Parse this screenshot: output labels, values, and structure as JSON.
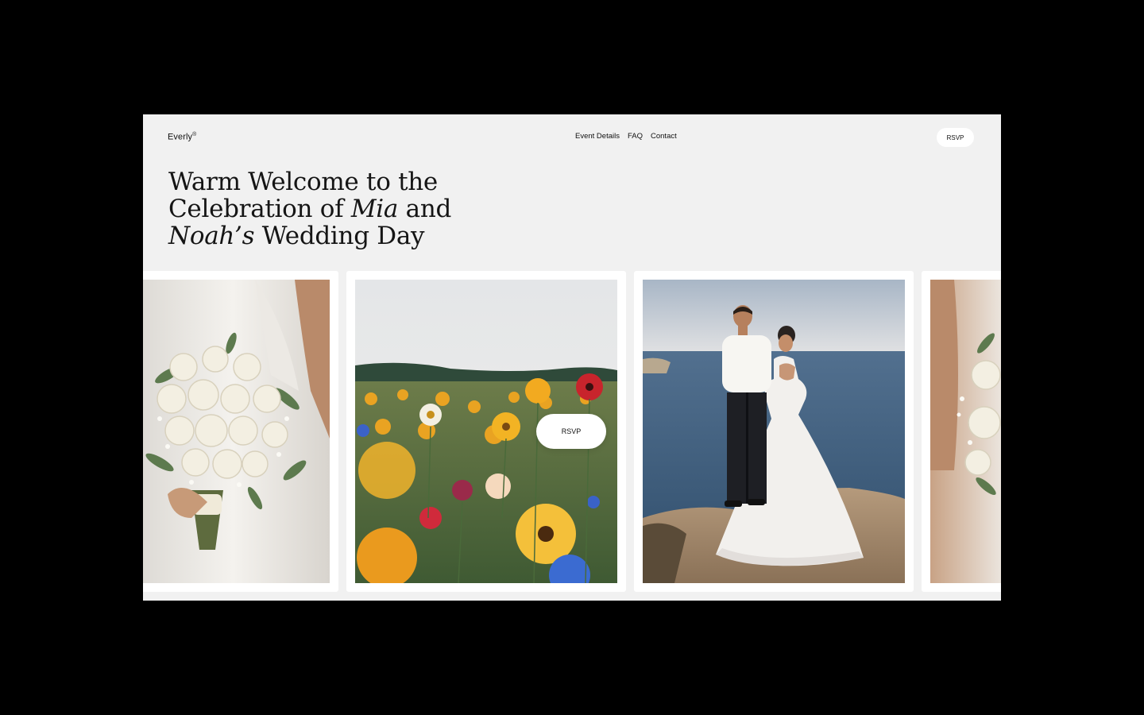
{
  "brand": {
    "name": "Everly",
    "mark": "®"
  },
  "nav": {
    "items": [
      "Event Details",
      "FAQ",
      "Contact"
    ]
  },
  "header": {
    "rsvp_label": "RSVP"
  },
  "hero": {
    "line1": "Warm Welcome to the",
    "line2_pre": "Celebration of ",
    "line2_em": "Mia",
    "line2_post": " and",
    "line3_em": "Noah’s",
    "line3_post": " Wedding Day"
  },
  "gallery": {
    "floating_rsvp_label": "RSVP",
    "photos": [
      "bouquet",
      "wildflowers",
      "couple-by-sea",
      "bouquet"
    ]
  }
}
